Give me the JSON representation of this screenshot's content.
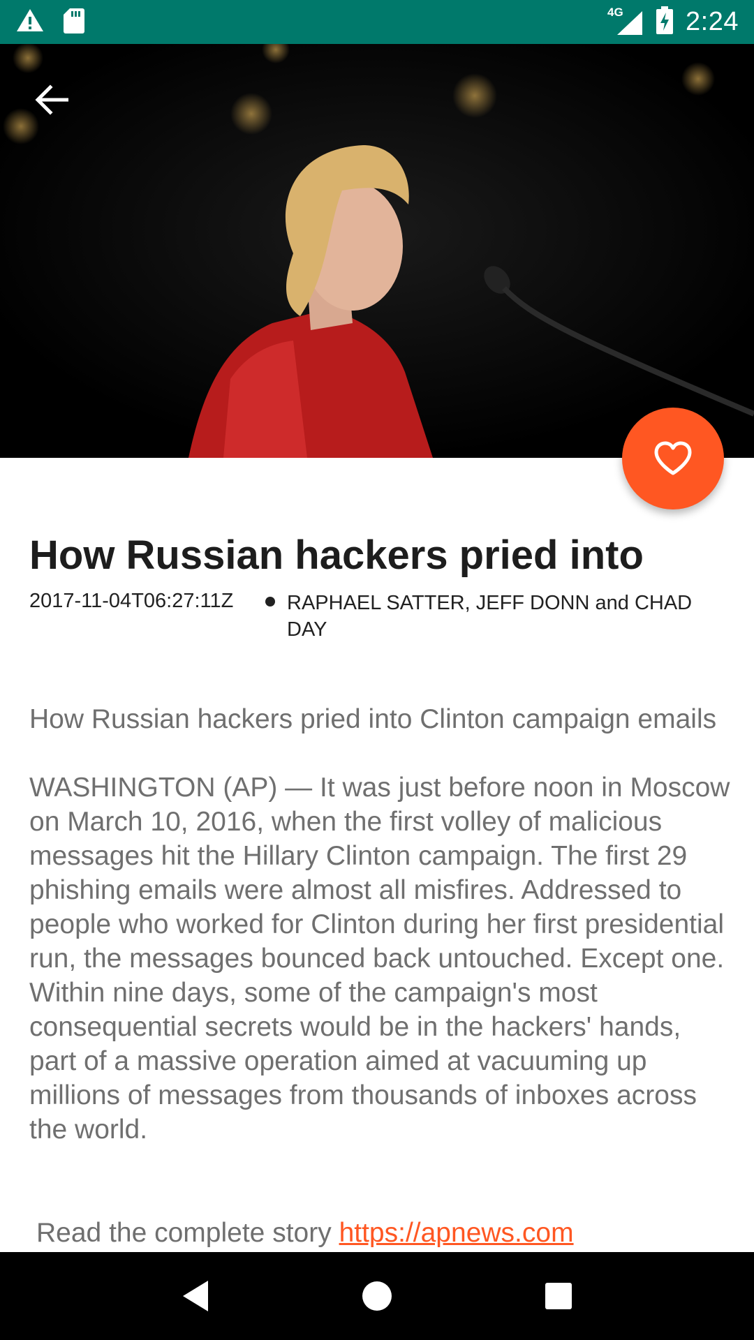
{
  "status_bar": {
    "time": "2:24",
    "network_label": "4G",
    "background_color": "#00796B",
    "icons": [
      "alert-icon",
      "sd-card-icon",
      "signal-icon",
      "battery-charging-icon"
    ]
  },
  "hero": {
    "image_description_icon": "article-photo",
    "back_icon": "arrow-back-icon"
  },
  "fab": {
    "icon": "heart-outline-icon",
    "color": "#FF5722"
  },
  "article": {
    "title": "How Russian hackers pried into",
    "date": "2017-11-04T06:27:11Z",
    "authors": "RAPHAEL SATTER, JEFF DONN and CHAD DAY",
    "body": "How Russian hackers pried into Clinton campaign emails\n\nWASHINGTON (AP) — It was just before noon in Moscow on March 10, 2016, when the first volley of malicious messages hit the Hillary Clinton campaign. The first 29 phishing emails were almost all misfires. Addressed to people who worked for Clinton during her first presidential run, the messages bounced back untouched. Except one. Within nine days, some of the campaign's most consequential secrets would be in the hackers' hands, part of a massive operation aimed at vacuuming up millions of messages from thousands of inboxes across the world.",
    "read_more_label": "Read the complete story",
    "read_more_link": "https://apnews.com",
    "link_color": "#FF5722"
  },
  "nav_bar": {
    "icons": [
      "back-triangle-icon",
      "home-circle-icon",
      "recents-square-icon"
    ]
  }
}
